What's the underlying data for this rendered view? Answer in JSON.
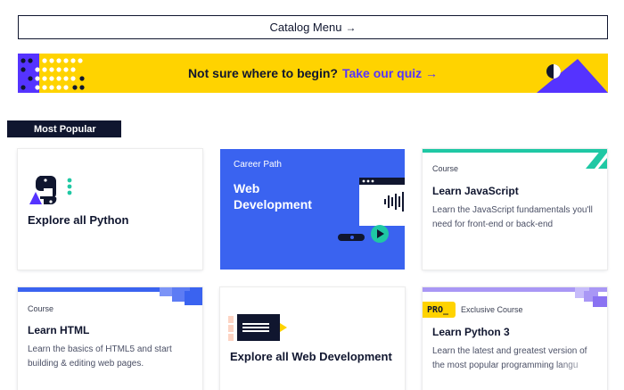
{
  "catalog": {
    "label": "Catalog Menu",
    "arrow": "→"
  },
  "quiz_banner": {
    "prompt": "Not sure where to begin?",
    "link": "Take our quiz",
    "arrow": "→",
    "bg": "#ffd300",
    "link_color": "#5533ff"
  },
  "section": {
    "label": "Most Popular"
  },
  "cards": [
    {
      "title": "Explore all Python",
      "icon": "python-icon"
    },
    {
      "kind": "Career Path",
      "title_line1": "Web",
      "title_line2": "Development",
      "bg": "#3a63f0",
      "icon": "video-player-icon"
    },
    {
      "kind": "Course",
      "title": "Learn JavaScript",
      "desc_line1": "Learn the JavaScript fundamentals you'll",
      "desc_line2": "need for front-end or back-end",
      "accent": "#1fc8a4"
    },
    {
      "kind": "Course",
      "title": "Learn HTML",
      "desc_line1": "Learn the basics of HTML5 and start",
      "desc_line2": "building & editing web pages.",
      "accent": "#3a63f0"
    },
    {
      "title": "Explore all Web Development",
      "icon": "code-window-icon"
    },
    {
      "badge": "PRO_",
      "kind": "Exclusive Course",
      "title": "Learn Python 3",
      "desc_line1": "Learn the latest and greatest version of",
      "desc_line2": "the most popular programming langu",
      "accent": "#a997f5"
    }
  ]
}
